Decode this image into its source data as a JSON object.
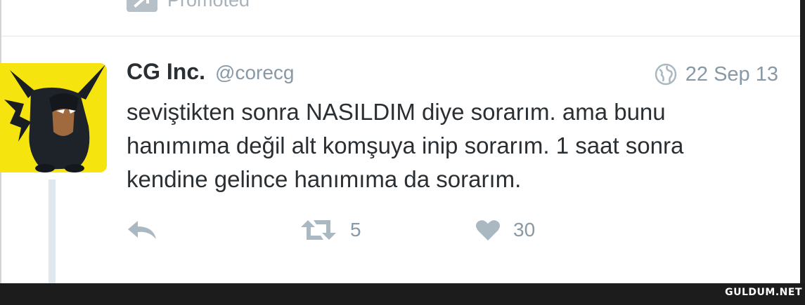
{
  "promoted": {
    "label": "Promoted",
    "icon": "promoted-arrow-icon"
  },
  "tweet": {
    "author": {
      "display_name": "CG Inc.",
      "handle": "@corecg",
      "avatar": "pikachu-batman-avatar"
    },
    "timestamp": {
      "icon": "globe-icon",
      "label": "22 Sep 13"
    },
    "text_lines": [
      "seviştikten sonra NASILDIM diye sorarım. ama bunu",
      "hanımıma değil alt komşuya inip sorarım. 1 saat sonra",
      "kendine gelince hanımıma da sorarım."
    ],
    "actions": {
      "reply": {
        "icon": "reply-icon"
      },
      "retweet": {
        "icon": "retweet-icon",
        "count": "5"
      },
      "like": {
        "icon": "heart-icon",
        "count": "30"
      }
    }
  },
  "watermark": "GULDUM.NET",
  "colors": {
    "text": "#292f33",
    "muted": "#8899a6",
    "avatar_bg": "#f6e40f",
    "thread_line": "#e1e8ed"
  }
}
